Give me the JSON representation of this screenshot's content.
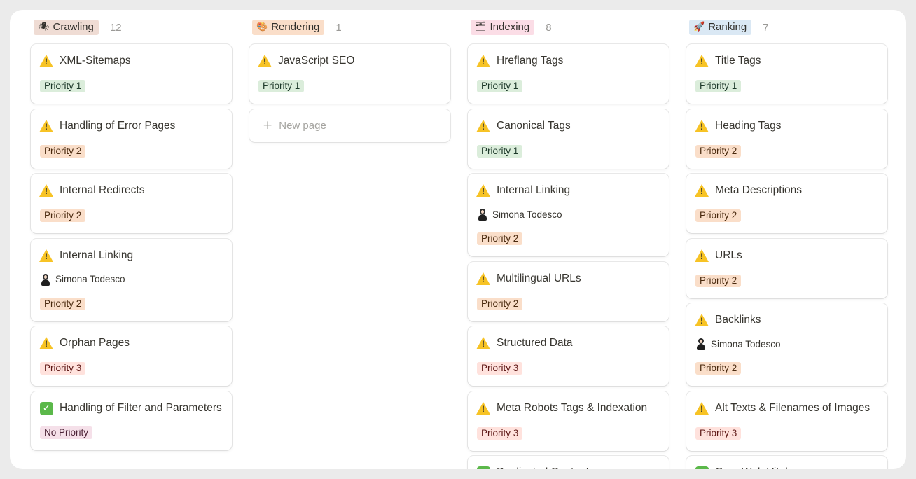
{
  "colors": {
    "priority_1": "#dbeddb",
    "priority_2": "#fadec9",
    "priority_3": "#ffe2dd",
    "no_priority": "#f5e0e9"
  },
  "columns": [
    {
      "title": "Crawling",
      "icon": "spider-icon",
      "emoji": "🕷",
      "tag_color": "#efdcd4",
      "count": "12",
      "cards": [
        {
          "title": "XML-Sitemaps",
          "status": "warning",
          "priority": "Priority 1",
          "level": "p1"
        },
        {
          "title": "Handling of Error Pages",
          "status": "warning",
          "priority": "Priority 2",
          "level": "p2"
        },
        {
          "title": "Internal Redirects",
          "status": "warning",
          "priority": "Priority 2",
          "level": "p2"
        },
        {
          "title": "Internal Linking",
          "status": "warning",
          "assignee": "Simona Todesco",
          "priority": "Priority 2",
          "level": "p2"
        },
        {
          "title": "Orphan Pages",
          "status": "warning",
          "priority": "Priority 3",
          "level": "p3"
        },
        {
          "title": "Handling of Filter and Parameters",
          "status": "done",
          "priority": "No Priority",
          "level": "p0",
          "two_line": true
        }
      ]
    },
    {
      "title": "Rendering",
      "icon": "palette-icon",
      "emoji": "🎨",
      "tag_color": "#fadec9",
      "count": "1",
      "cards": [
        {
          "title": "JavaScript SEO",
          "status": "warning",
          "priority": "Priority 1",
          "level": "p1"
        }
      ],
      "new_page": "New page"
    },
    {
      "title": "Indexing",
      "icon": "card-index-icon",
      "emoji": "🗂",
      "tag_color": "#fbdde6",
      "count": "8",
      "cards": [
        {
          "title": "Hreflang Tags",
          "status": "warning",
          "priority": "Priority 1",
          "level": "p1"
        },
        {
          "title": "Canonical Tags",
          "status": "warning",
          "priority": "Priority 1",
          "level": "p1"
        },
        {
          "title": "Internal Linking",
          "status": "warning",
          "assignee": "Simona Todesco",
          "priority": "Priority 2",
          "level": "p2"
        },
        {
          "title": "Multilingual URLs",
          "status": "warning",
          "priority": "Priority 2",
          "level": "p2"
        },
        {
          "title": "Structured Data",
          "status": "warning",
          "priority": "Priority 3",
          "level": "p3"
        },
        {
          "title": "Meta Robots Tags & Indexation",
          "status": "warning",
          "priority": "Priority 3",
          "level": "p3"
        },
        {
          "title": "Duplicated Content",
          "status": "done",
          "priority": "",
          "level": "p0"
        }
      ]
    },
    {
      "title": "Ranking",
      "icon": "rocket-icon",
      "emoji": "🚀",
      "tag_color": "#dae8f4",
      "count": "7",
      "cards": [
        {
          "title": "Title Tags",
          "status": "warning",
          "priority": "Priority 1",
          "level": "p1"
        },
        {
          "title": "Heading Tags",
          "status": "warning",
          "priority": "Priority 2",
          "level": "p2"
        },
        {
          "title": "Meta Descriptions",
          "status": "warning",
          "priority": "Priority 2",
          "level": "p2"
        },
        {
          "title": "URLs",
          "status": "warning",
          "priority": "Priority 2",
          "level": "p2"
        },
        {
          "title": "Backlinks",
          "status": "warning",
          "assignee": "Simona Todesco",
          "priority": "Priority 2",
          "level": "p2"
        },
        {
          "title": "Alt Texts & Filenames of Images",
          "status": "warning",
          "priority": "Priority 3",
          "level": "p3"
        },
        {
          "title": "Core Web Vitals",
          "status": "done",
          "priority": "",
          "level": "p0"
        }
      ]
    }
  ]
}
